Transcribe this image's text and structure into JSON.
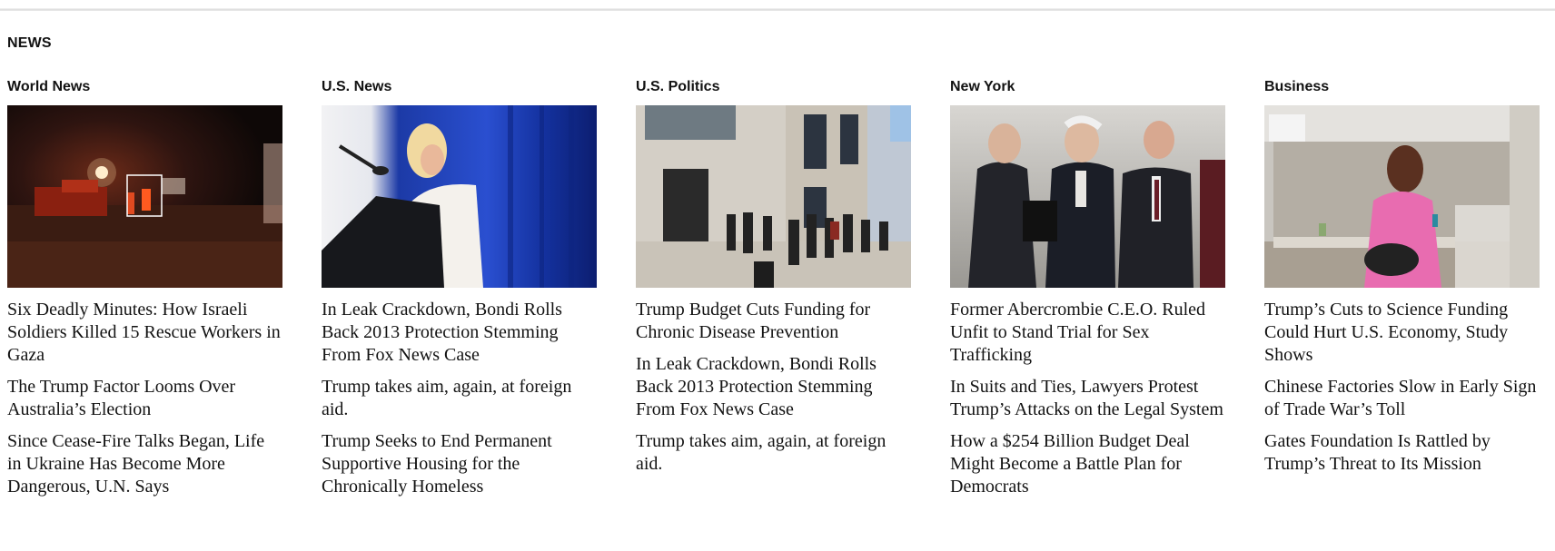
{
  "section": {
    "title": "NEWS"
  },
  "columns": [
    {
      "title": "World News",
      "image_alt": "Nighttime scene of emergency vehicles with a highlighted figure",
      "headlines": [
        "Six Deadly Minutes: How Israeli Soldiers Killed 15 Rescue Workers in Gaza",
        "The Trump Factor Looms Over Australia’s Election",
        "Since Cease-Fire Talks Began, Life in Ukraine Has Become More Dangerous, U.N. Says"
      ]
    },
    {
      "title": "U.S. News",
      "image_alt": "Woman in white suit speaking at a podium before a blue curtain",
      "headlines": [
        "In Leak Crackdown, Bondi Rolls Back 2013 Protection Stemming From Fox News Case",
        "Trump takes aim, again, at foreign aid.",
        "Trump Seeks to End Permanent Supportive Housing for the Chronically Homeless"
      ]
    },
    {
      "title": "U.S. Politics",
      "image_alt": "People lined up outside a government building",
      "headlines": [
        "Trump Budget Cuts Funding for Chronic Disease Prevention",
        "In Leak Crackdown, Bondi Rolls Back 2013 Protection Stemming From Fox News Case",
        "Trump takes aim, again, at foreign aid."
      ]
    },
    {
      "title": "New York",
      "image_alt": "Three men in suits walking outside",
      "headlines": [
        "Former Abercrombie C.E.O. Ruled Unfit to Stand Trial for Sex Trafficking",
        "In Suits and Ties, Lawyers Protest Trump’s Attacks on the Legal System",
        "How a $254 Billion Budget Deal Might Become a Battle Plan for Democrats"
      ]
    },
    {
      "title": "Business",
      "image_alt": "Researcher in pink lab coat working at a laboratory hood",
      "headlines": [
        "Trump’s Cuts to Science Funding Could Hurt U.S. Economy, Study Shows",
        "Chinese Factories Slow in Early Sign of Trade War’s Toll",
        "Gates Foundation Is Rattled by Trump’s Threat to Its Mission"
      ]
    }
  ]
}
